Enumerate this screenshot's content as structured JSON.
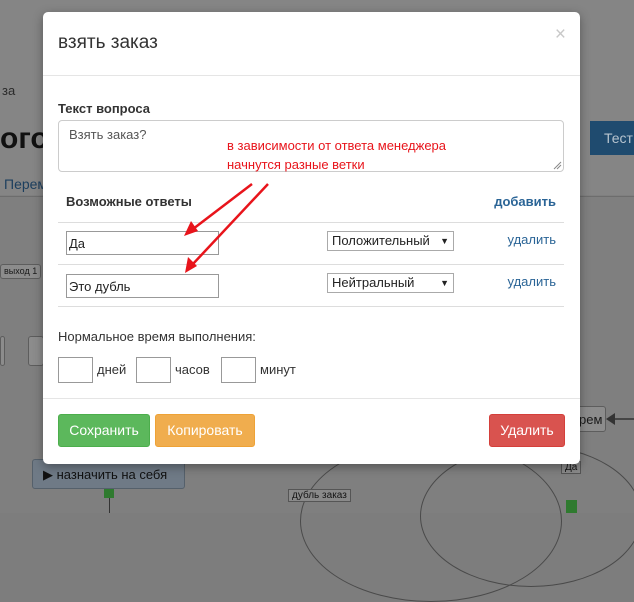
{
  "background": {
    "crumb": "за",
    "title": "ого",
    "link": "Переме",
    "test_button": "Тест",
    "node_exit": "выход 1",
    "node_right": "рем",
    "assign_button": "▶ назначить на себя",
    "label_dublicate": "дубль заказ",
    "label_yes": "Да"
  },
  "modal": {
    "title": "взять заказ",
    "close_glyph": "×",
    "question_label": "Текст вопроса",
    "question_value": "Взять заказ?",
    "annotation_line1": "в зависимости от ответа менеджера",
    "annotation_line2": "начнутся разные ветки",
    "answers_title": "Возможные ответы",
    "add_label": "добавить",
    "answers": [
      {
        "value": "Да",
        "type": "Положительный",
        "delete_label": "удалить"
      },
      {
        "value": "Это дубль",
        "type": "Нейтральный",
        "delete_label": "удалить"
      }
    ],
    "normal_time_label": "Нормальное время выполнения:",
    "time_units": {
      "days": "дней",
      "hours": "часов",
      "minutes": "минут"
    },
    "buttons": {
      "save": "Сохранить",
      "copy": "Копировать",
      "delete": "Удалить"
    }
  },
  "colors": {
    "annotation": "#e8141b",
    "save": "#5cb85c",
    "copy": "#f0ad4e",
    "delete": "#d9534f",
    "link": "#2a6496"
  }
}
